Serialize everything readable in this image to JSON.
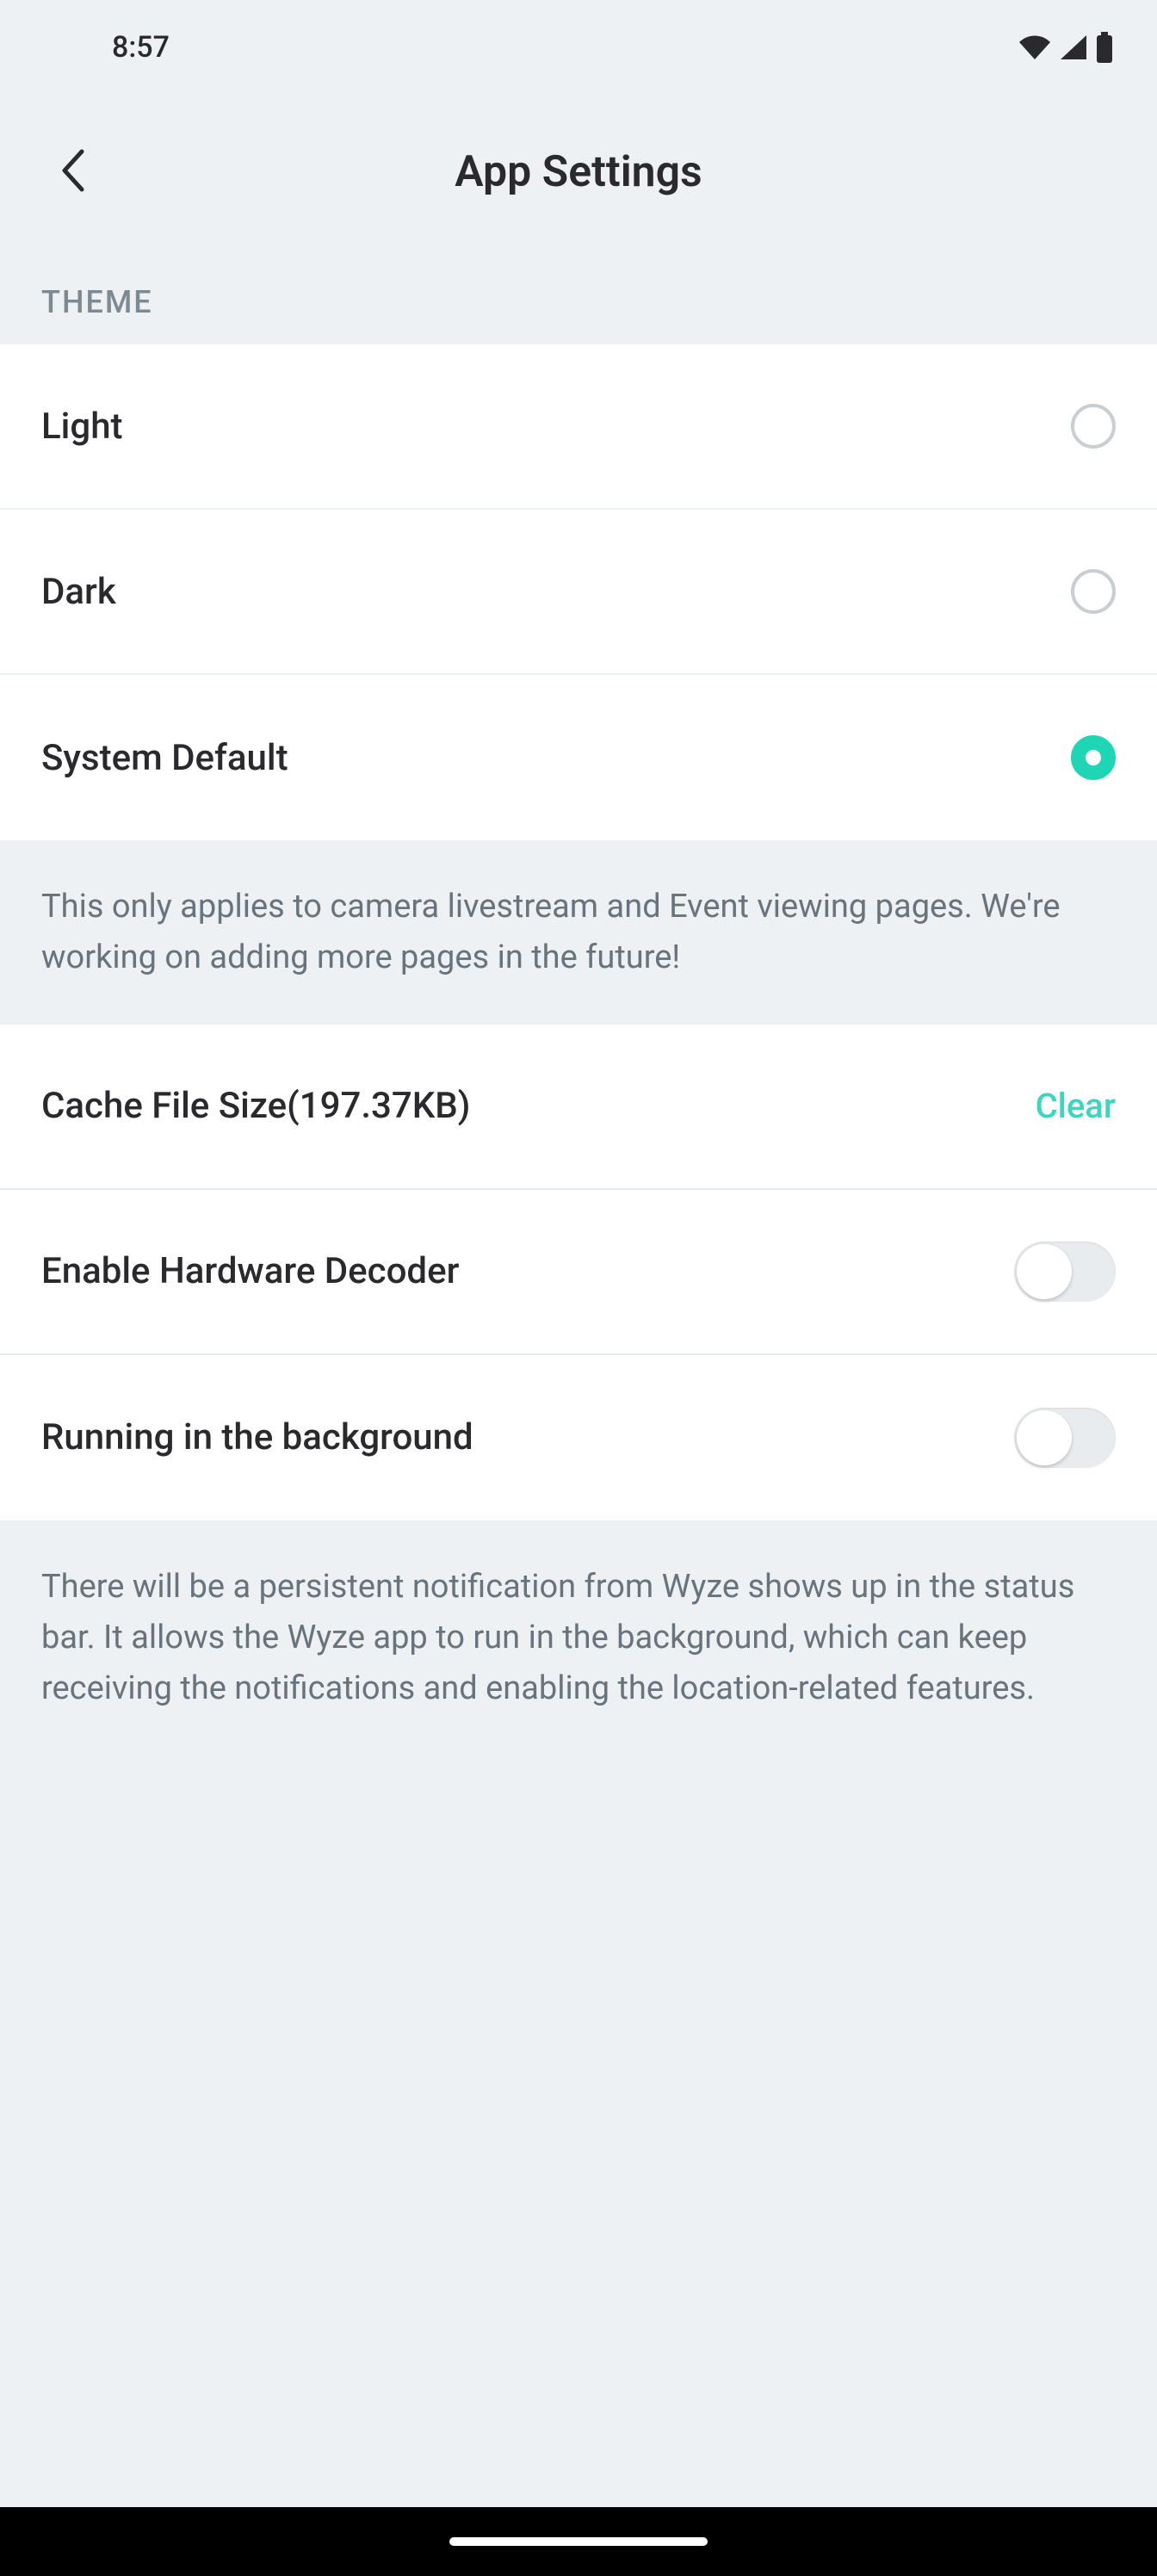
{
  "status": {
    "time": "8:57"
  },
  "header": {
    "title": "App Settings"
  },
  "theme": {
    "section_label": "THEME",
    "options": [
      {
        "label": "Light",
        "selected": false
      },
      {
        "label": "Dark",
        "selected": false
      },
      {
        "label": "System Default",
        "selected": true
      }
    ],
    "description": "This only applies to camera livestream and Event viewing pages. We're working on adding more pages in the future!"
  },
  "settings": {
    "cache": {
      "label": "Cache File Size(197.37KB)",
      "action_label": "Clear"
    },
    "hardware_decoder": {
      "label": "Enable Hardware Decoder",
      "enabled": false
    },
    "background": {
      "label": "Running in the background",
      "enabled": false,
      "description": "There will be a persistent notification from Wyze shows up in the status bar. It allows the Wyze app to run in the background, which can keep receiving the notifications and enabling the location-related features."
    }
  }
}
